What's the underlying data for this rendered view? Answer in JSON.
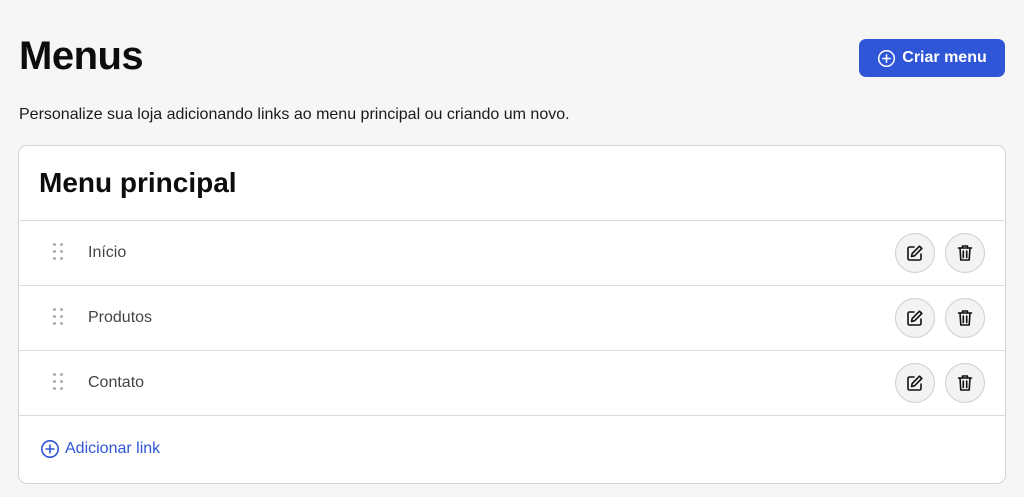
{
  "header": {
    "title": "Menus",
    "create_button_label": "Criar menu",
    "subtitle": "Personalize sua loja adicionando links ao menu principal ou criando um novo."
  },
  "menu_card": {
    "title": "Menu principal",
    "items": [
      {
        "label": "Início"
      },
      {
        "label": "Produtos"
      },
      {
        "label": "Contato"
      }
    ],
    "add_link_label": "Adicionar link"
  },
  "icons": {
    "create": "plus-circle-icon",
    "drag": "drag-handle-icon",
    "edit": "edit-icon",
    "delete": "trash-icon",
    "add": "plus-circle-icon"
  },
  "colors": {
    "accent": "#2f56d6",
    "background": "#f6f6f6",
    "card": "#ffffff"
  }
}
